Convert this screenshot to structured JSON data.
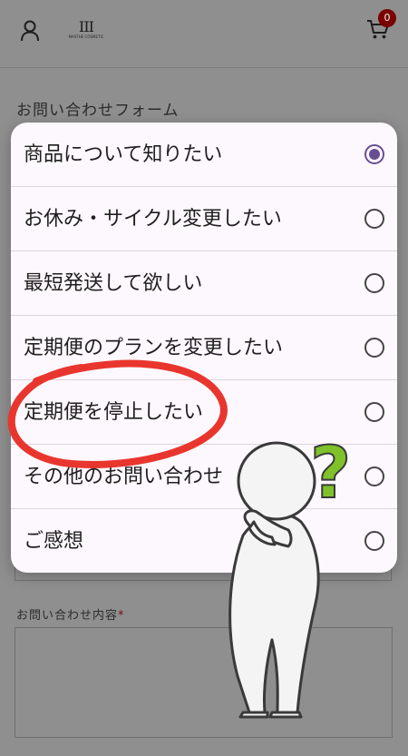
{
  "header": {
    "logo_text": "MASTHE COSMETIC",
    "cart_count": "0"
  },
  "form": {
    "title": "お問い合わせフォーム",
    "inquiry_label": "お問い合わせ内容",
    "required_mark": "*"
  },
  "dialog": {
    "options": [
      {
        "label": "商品について知りたい",
        "selected": true
      },
      {
        "label": "お休み・サイクル変更したい",
        "selected": false
      },
      {
        "label": "最短発送して欲しい",
        "selected": false
      },
      {
        "label": "定期便のプランを変更したい",
        "selected": false
      },
      {
        "label": "定期便を停止したい",
        "selected": false
      },
      {
        "label": "その他のお問い合わせ",
        "selected": false
      },
      {
        "label": "ご感想",
        "selected": false
      }
    ]
  },
  "overlay": {
    "question_mark": "?",
    "accent_circle_color": "#e8362f",
    "question_color": "#7fc12a"
  }
}
